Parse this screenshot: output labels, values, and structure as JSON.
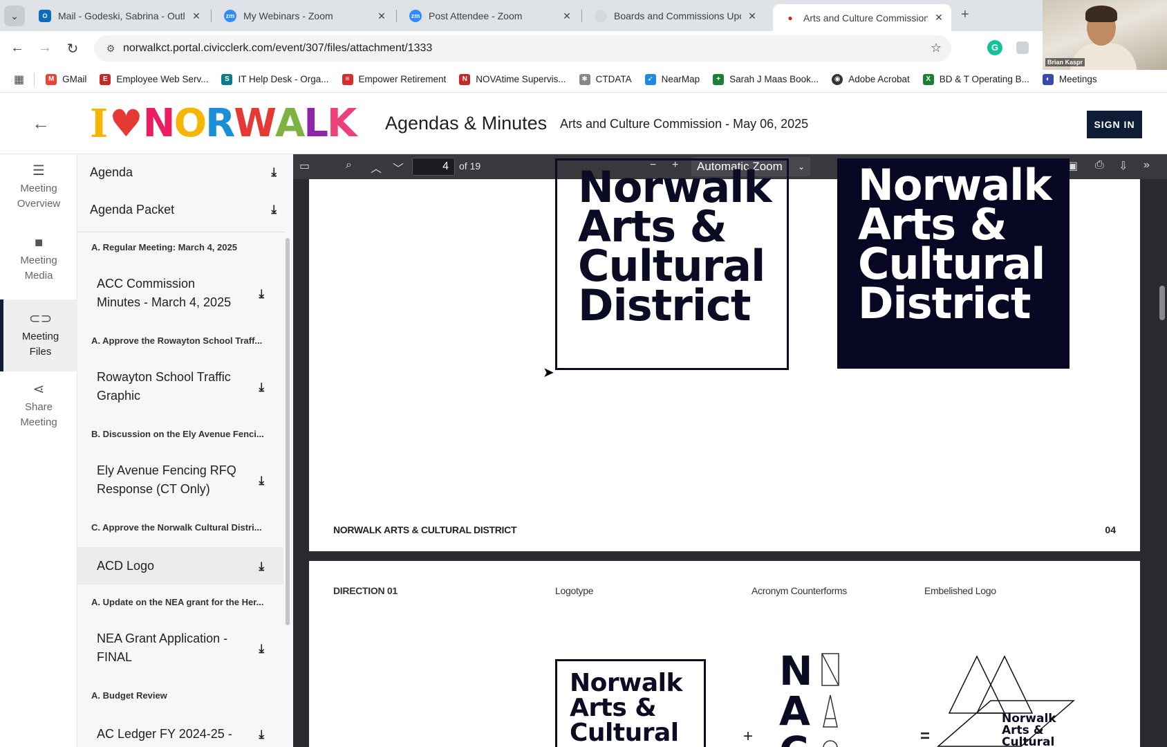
{
  "browser": {
    "tabs": [
      {
        "title": "Mail - Godeski, Sabrina - Outlo",
        "icon": "outlook-icon",
        "color": "#0f6cbd"
      },
      {
        "title": "My Webinars - Zoom",
        "icon": "zoom-icon",
        "color": "#2d8cff"
      },
      {
        "title": "Post Attendee - Zoom",
        "icon": "zoom-icon",
        "color": "#2d8cff"
      },
      {
        "title": "Boards and Commissions Upco",
        "icon": "globe-icon",
        "color": "#9aa0a6"
      },
      {
        "title": "Arts and Culture Commission -",
        "icon": "civicclerk-icon",
        "color": "#c62828"
      }
    ],
    "url": "norwalkct.portal.civicclerk.com/event/307/files/attachment/1333",
    "bookmarks": [
      {
        "label": "GMail",
        "color": "#ea4335"
      },
      {
        "label": "Employee Web Serv...",
        "color": "#c62828"
      },
      {
        "label": "IT Help Desk - Orga...",
        "color": "#0a7d8c"
      },
      {
        "label": "Empower Retirement",
        "color": "#d32f2f"
      },
      {
        "label": "NOVAtime Supervis...",
        "color": "#c62828"
      },
      {
        "label": "CTDATA",
        "color": "#888888"
      },
      {
        "label": "NearMap",
        "color": "#1e88e5"
      },
      {
        "label": "Sarah J Maas Book...",
        "color": "#188038"
      },
      {
        "label": "Adobe Acrobat",
        "color": "#333333"
      },
      {
        "label": "BD & T Operating B...",
        "color": "#1e7e34"
      },
      {
        "label": "Meetings",
        "color": "#3949ab"
      }
    ],
    "webcam_name": "Brian Kaspr"
  },
  "header": {
    "logo_letters": [
      "N",
      "O",
      "R",
      "W",
      "A",
      "L",
      "K"
    ],
    "logo_colors": [
      "#e91e63",
      "#f7b500",
      "#1a8fd8",
      "#e53935",
      "#7cb342",
      "#8e24aa",
      "#ec407a"
    ],
    "heart_color": "#e53935",
    "title": "Agendas & Minutes",
    "subtitle": "Arts and Culture Commission - May 06, 2025",
    "signin": "SIGN IN"
  },
  "rail": [
    {
      "label1": "Meeting",
      "label2": "Overview",
      "icon": "list-icon"
    },
    {
      "label1": "Meeting",
      "label2": "Media",
      "icon": "video-camera-icon"
    },
    {
      "label1": "Meeting",
      "label2": "Files",
      "icon": "paperclip-icon"
    },
    {
      "label1": "Share",
      "label2": "Meeting",
      "icon": "share-icon"
    }
  ],
  "files": {
    "top": [
      "Agenda",
      "Agenda Packet"
    ],
    "sections": [
      "A. Regular Meeting: March 4, 2025",
      "A. Approve the Rowayton School Traff...",
      "B. Discussion on the Ely Avenue Fenci...",
      "C. Approve the Norwalk Cultural Distri...",
      "A. Update on the NEA grant for the Her...",
      "A. Budget Review"
    ],
    "items": [
      "ACC Commission Minutes - March 4, 2025",
      "Rowayton School Traffic Graphic",
      "Ely Avenue Fencing RFQ Response (CT Only)",
      "ACD Logo",
      "NEA Grant Application - FINAL",
      "AC Ledger FY 2024-25 -"
    ]
  },
  "pdf": {
    "page": "4",
    "of": "of 19",
    "zoom": "Automatic Zoom",
    "logo_lines": [
      "Norwalk",
      "Arts &",
      "Cultural",
      "District"
    ],
    "footer_left": "NORWALK ARTS & CULTURAL DISTRICT",
    "footer_right": "04",
    "p2_labels": [
      "DIRECTION 01",
      "Logotype",
      "Acronym Counterforms",
      "Embelished Logo"
    ],
    "mini_lines": [
      "Norwalk",
      "Arts &",
      "Cultural"
    ],
    "nac": [
      "N",
      "A",
      "C"
    ],
    "emb_lines": [
      "Norwalk",
      "Arts &",
      "Cultural"
    ]
  }
}
